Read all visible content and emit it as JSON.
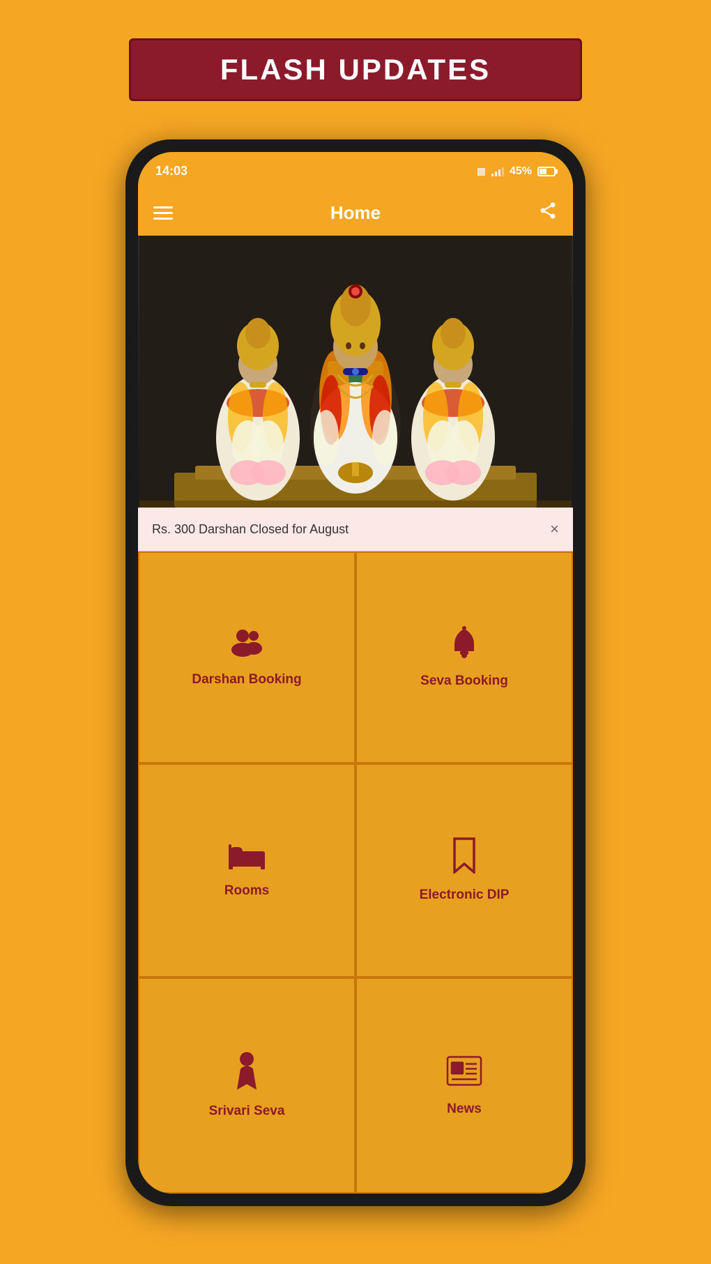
{
  "flash_banner": {
    "text": "FLASH UPDATES"
  },
  "status_bar": {
    "time": "14:03",
    "battery_percent": "45%"
  },
  "header": {
    "title": "Home"
  },
  "notification": {
    "text": "Rs. 300 Darshan Closed for August",
    "close_label": "×"
  },
  "menu_items": [
    {
      "id": "darshan-booking",
      "label": "Darshan Booking",
      "icon": "people"
    },
    {
      "id": "seva-booking",
      "label": "Seva Booking",
      "icon": "bell"
    },
    {
      "id": "rooms",
      "label": "Rooms",
      "icon": "bed"
    },
    {
      "id": "electronic-dip",
      "label": "Electronic DIP",
      "icon": "bookmark"
    },
    {
      "id": "srivari-seva",
      "label": "Srivari Seva",
      "icon": "person"
    },
    {
      "id": "news",
      "label": "News",
      "icon": "newspaper"
    }
  ],
  "colors": {
    "primary_bg": "#F5A623",
    "dark_red": "#8B1A2A",
    "cell_bg": "#E8A020",
    "cell_border": "#C8780A",
    "notif_bg": "#FDE8E8"
  }
}
